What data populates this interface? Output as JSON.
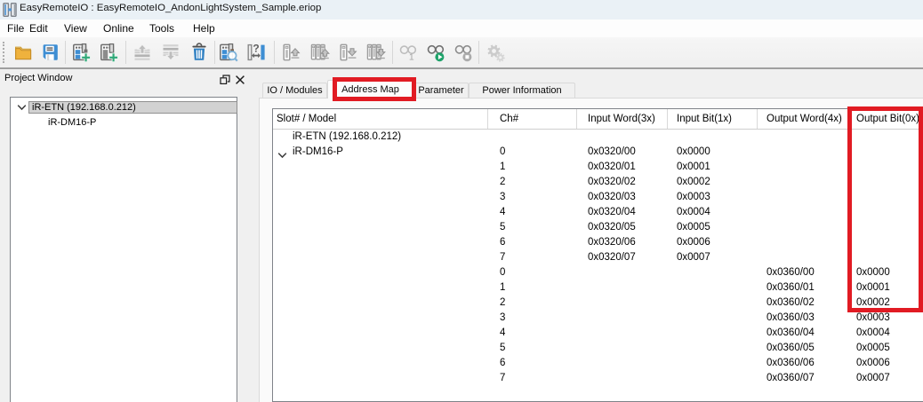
{
  "window": {
    "title": "EasyRemoteIO : EasyRemoteIO_AndonLightSystem_Sample.eriop",
    "app_icon": "easyremoteio-logo"
  },
  "menu": {
    "items": [
      "File",
      "Edit",
      "View",
      "Online",
      "Tools",
      "Help"
    ]
  },
  "toolbar": {
    "buttons": [
      {
        "name": "open-project",
        "icon": "open-folder-icon",
        "enabled": true
      },
      {
        "name": "save-project",
        "icon": "save-floppy-icon",
        "enabled": true
      },
      {
        "name": "add-remote-io",
        "icon": "add-remote-io-icon",
        "enabled": true
      },
      {
        "name": "add-io-module",
        "icon": "add-io-module-icon",
        "enabled": true
      },
      {
        "name": "move-module-up",
        "icon": "move-up-icon",
        "enabled": false
      },
      {
        "name": "move-module-down",
        "icon": "move-down-icon",
        "enabled": false
      },
      {
        "name": "delete-module",
        "icon": "trash-icon",
        "enabled": true
      },
      {
        "name": "scan-modules",
        "icon": "scan-module-icon",
        "enabled": true
      },
      {
        "name": "assign-address",
        "icon": "assign-address-icon",
        "enabled": true
      },
      {
        "name": "upload-module",
        "icon": "upload-single-icon",
        "enabled": true
      },
      {
        "name": "upload-all-modules",
        "icon": "upload-all-icon",
        "enabled": true
      },
      {
        "name": "download-module",
        "icon": "download-single-icon",
        "enabled": true
      },
      {
        "name": "download-all-modules",
        "icon": "download-all-icon",
        "enabled": true
      },
      {
        "name": "monitor-single",
        "icon": "monitor-one-icon",
        "enabled": true
      },
      {
        "name": "monitor-start",
        "icon": "monitor-run-icon",
        "enabled": true
      },
      {
        "name": "monitor-stop",
        "icon": "monitor-stop-icon",
        "enabled": true
      },
      {
        "name": "settings",
        "icon": "gears-icon",
        "enabled": false
      }
    ]
  },
  "project_window": {
    "title": "Project Window",
    "tree": {
      "root": {
        "label": "iR-ETN (192.168.0.212)",
        "expanded": true,
        "selected": true
      },
      "child": {
        "label": "iR-DM16-P"
      }
    }
  },
  "tabs": [
    {
      "label": "IO / Modules",
      "active": false
    },
    {
      "label": "Address Map",
      "active": true,
      "annotated": true
    },
    {
      "label": "Parameter",
      "active": false
    },
    {
      "label": "Power Information",
      "active": false
    }
  ],
  "address_map_table": {
    "columns": [
      "Slot# / Model",
      "Ch#",
      "Input Word(3x)",
      "Input Bit(1x)",
      "Output Word(4x)",
      "Output Bit(0x)"
    ],
    "annotated_column": "Output Bit(0x)",
    "rows": [
      {
        "slot": "iR-ETN (192.168.0.212)",
        "expander": false,
        "ch": "",
        "iw": "",
        "ib": "",
        "ow": "",
        "ob": ""
      },
      {
        "slot": "iR-DM16-P",
        "expander": true,
        "ch": "0",
        "iw": "0x0320/00",
        "ib": "0x0000",
        "ow": "",
        "ob": ""
      },
      {
        "slot": "",
        "expander": false,
        "ch": "1",
        "iw": "0x0320/01",
        "ib": "0x0001",
        "ow": "",
        "ob": ""
      },
      {
        "slot": "",
        "expander": false,
        "ch": "2",
        "iw": "0x0320/02",
        "ib": "0x0002",
        "ow": "",
        "ob": ""
      },
      {
        "slot": "",
        "expander": false,
        "ch": "3",
        "iw": "0x0320/03",
        "ib": "0x0003",
        "ow": "",
        "ob": ""
      },
      {
        "slot": "",
        "expander": false,
        "ch": "4",
        "iw": "0x0320/04",
        "ib": "0x0004",
        "ow": "",
        "ob": ""
      },
      {
        "slot": "",
        "expander": false,
        "ch": "5",
        "iw": "0x0320/05",
        "ib": "0x0005",
        "ow": "",
        "ob": ""
      },
      {
        "slot": "",
        "expander": false,
        "ch": "6",
        "iw": "0x0320/06",
        "ib": "0x0006",
        "ow": "",
        "ob": ""
      },
      {
        "slot": "",
        "expander": false,
        "ch": "7",
        "iw": "0x0320/07",
        "ib": "0x0007",
        "ow": "",
        "ob": ""
      },
      {
        "slot": "",
        "expander": false,
        "ch": "0",
        "iw": "",
        "ib": "",
        "ow": "0x0360/00",
        "ob": "0x0000"
      },
      {
        "slot": "",
        "expander": false,
        "ch": "1",
        "iw": "",
        "ib": "",
        "ow": "0x0360/01",
        "ob": "0x0001"
      },
      {
        "slot": "",
        "expander": false,
        "ch": "2",
        "iw": "",
        "ib": "",
        "ow": "0x0360/02",
        "ob": "0x0002"
      },
      {
        "slot": "",
        "expander": false,
        "ch": "3",
        "iw": "",
        "ib": "",
        "ow": "0x0360/03",
        "ob": "0x0003"
      },
      {
        "slot": "",
        "expander": false,
        "ch": "4",
        "iw": "",
        "ib": "",
        "ow": "0x0360/04",
        "ob": "0x0004"
      },
      {
        "slot": "",
        "expander": false,
        "ch": "5",
        "iw": "",
        "ib": "",
        "ow": "0x0360/05",
        "ob": "0x0005"
      },
      {
        "slot": "",
        "expander": false,
        "ch": "6",
        "iw": "",
        "ib": "",
        "ow": "0x0360/06",
        "ob": "0x0006"
      },
      {
        "slot": "",
        "expander": false,
        "ch": "7",
        "iw": "",
        "ib": "",
        "ow": "0x0360/07",
        "ob": "0x0007"
      }
    ]
  },
  "annotations": {
    "color": "#e11b23",
    "highlighted_tab": "Address Map",
    "highlighted_column": "Output Bit(0x)"
  }
}
